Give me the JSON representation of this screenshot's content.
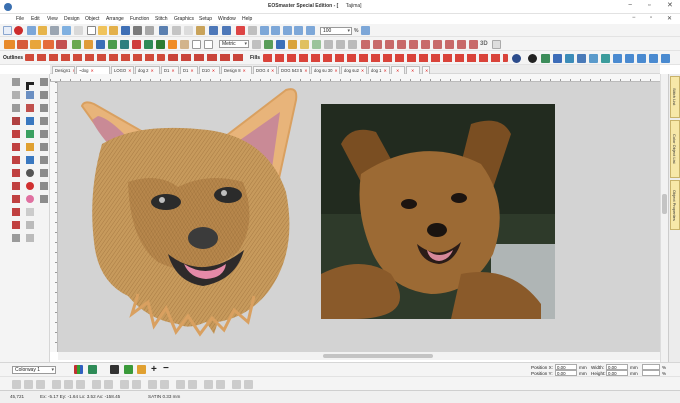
{
  "window": {
    "title": "EOSmaster Special Edition - [",
    "document": "Tajima]",
    "min": "−",
    "max": "▫",
    "close": "✕"
  },
  "menu": {
    "items": [
      "File",
      "Edit",
      "View",
      "Design",
      "Object",
      "Arrange",
      "Function",
      "Stitch",
      "Graphics",
      "Setup",
      "Window",
      "Help"
    ],
    "controls": [
      "−",
      "▫",
      "✕"
    ]
  },
  "toolbar": {
    "zoom_value": "100",
    "zoom_unit": "%",
    "mode_value": "Metric",
    "outlines_label": "Outlines",
    "fills_label": "Fills",
    "threed_label": "3D"
  },
  "tabs": [
    "Design1",
    "~dog",
    "LOGO",
    "dog 2",
    "D1",
    "D1",
    "D10",
    "Design 8",
    "DOG 4",
    "DOG 543 5",
    "dog su 30",
    "dog su2",
    "dog 1",
    "",
    ""
  ],
  "tab_close": "✕",
  "side_panels": [
    "Stitch List",
    "Color Object List",
    "Object Properties"
  ],
  "bottom": {
    "colorway_value": "Colorway 1",
    "plus_label": "+",
    "minus_label": "−",
    "position_x_label": "Position X:",
    "position_x_value": "0.00",
    "position_y_label": "Position Y:",
    "position_y_value": "0.00",
    "width_label": "Width:",
    "width_value": "0.00",
    "height_label": "Height:",
    "height_value": "0.00",
    "unit_mm": "mm",
    "unit_pct": "%"
  },
  "status": {
    "code": "45,721",
    "coords": "Ex: -5.17 Ey: -1.64 Lx: 3.52 Ax: -158.45",
    "stitch": "SATIN 0.33 mm"
  },
  "colors": {
    "accent": "#2f6cc0",
    "canvas": "#d3d3d3",
    "side_tab": "#f7e8a8"
  }
}
